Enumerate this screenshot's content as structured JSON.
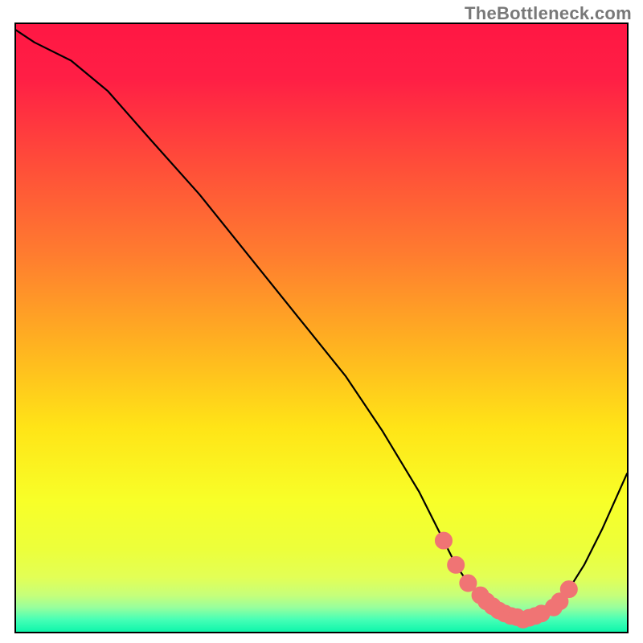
{
  "watermark": "TheBottleneck.com",
  "chart_data": {
    "type": "line",
    "title": "",
    "xlabel": "",
    "ylabel": "",
    "xlim": [
      0,
      100
    ],
    "ylim": [
      0,
      100
    ],
    "series": [
      {
        "name": "bottleneck-curve",
        "x": [
          0,
          3,
          9,
          15,
          22,
          30,
          38,
          46,
          54,
          60,
          66,
          70,
          72,
          74,
          77,
          80,
          83,
          86,
          89,
          90.5,
          93,
          96,
          100
        ],
        "y": [
          99,
          97,
          94,
          89,
          81,
          72,
          62,
          52,
          42,
          33,
          23,
          15,
          11,
          8,
          5,
          3,
          2,
          3,
          5,
          7,
          11,
          17,
          26
        ]
      },
      {
        "name": "highlight-dots",
        "x": [
          70,
          72,
          74,
          76,
          77,
          78,
          79,
          80,
          81,
          82,
          83,
          84,
          85,
          86,
          88,
          89,
          90.5
        ],
        "y": [
          15,
          11,
          8,
          6,
          5,
          4.2,
          3.5,
          3,
          2.6,
          2.4,
          2,
          2.3,
          2.6,
          3,
          4,
          5,
          7
        ]
      }
    ],
    "gradient_stops": [
      {
        "pos": 0.0,
        "color": "#ff1744"
      },
      {
        "pos": 0.09,
        "color": "#ff1f45"
      },
      {
        "pos": 0.22,
        "color": "#ff4a3a"
      },
      {
        "pos": 0.38,
        "color": "#ff7d2f"
      },
      {
        "pos": 0.52,
        "color": "#ffb021"
      },
      {
        "pos": 0.66,
        "color": "#ffe417"
      },
      {
        "pos": 0.78,
        "color": "#f8ff28"
      },
      {
        "pos": 0.86,
        "color": "#ecff3b"
      },
      {
        "pos": 0.905,
        "color": "#e3ff55"
      },
      {
        "pos": 0.935,
        "color": "#c6ff7a"
      },
      {
        "pos": 0.955,
        "color": "#98ff9d"
      },
      {
        "pos": 0.975,
        "color": "#46ffb6"
      },
      {
        "pos": 1.0,
        "color": "#00f3a8"
      }
    ]
  }
}
